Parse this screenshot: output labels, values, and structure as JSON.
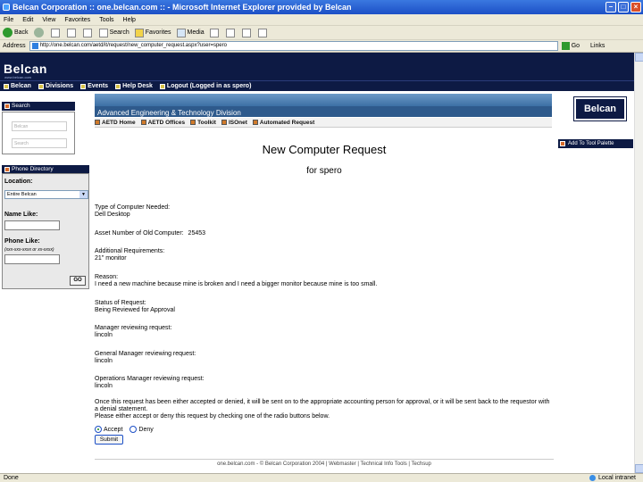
{
  "window": {
    "title": "Belcan Corporation :: one.belcan.com :: - Microsoft Internet Explorer provided by Belcan"
  },
  "menu": [
    "File",
    "Edit",
    "View",
    "Favorites",
    "Tools",
    "Help"
  ],
  "toolbar": {
    "back": "Back",
    "search": "Search",
    "favorites": "Favorites",
    "media": "Media"
  },
  "address": {
    "label": "Address",
    "url": "http://one.belcan.com/aetd/it/request/new_computer_request.aspx?user=spero",
    "go": "Go",
    "links": "Links"
  },
  "site": {
    "logo": "Belcan",
    "logo_sub": "www.belcan.com",
    "nav": [
      "Belcan",
      "Divisions",
      "Events",
      "Help Desk",
      "Logout (Logged in as spero)"
    ]
  },
  "search_panel": {
    "title": "Search",
    "field1": "Belcan",
    "field2": "Search"
  },
  "phone_panel": {
    "title": "Phone Directory",
    "location_label": "Location:",
    "location_value": "Entire Belcan",
    "name_label": "Name Like:",
    "phone_label": "Phone Like:",
    "phone_hint": "(xxx-xxx-xxxx or xx-xxxx)",
    "go": "GO"
  },
  "division": {
    "title": "Advanced Engineering & Technology Division",
    "nav": [
      "AETD Home",
      "AETD Offices",
      "Toolkit",
      "ISOnet",
      "Automated Request"
    ]
  },
  "badge": "Belcan",
  "add_toolbar": "Add To Tool Palette",
  "page": {
    "heading": "New Computer Request",
    "subheading": "for spero",
    "fields": [
      {
        "label": "Type of Computer Needed:",
        "value": "Dell Desktop"
      },
      {
        "label": "Asset Number of Old Computer:",
        "value": "25453"
      },
      {
        "label": "Additional Requirements:",
        "value": "21\" monitor"
      },
      {
        "label": "Reason:",
        "value": "I need a new machine because mine is broken and I need a bigger monitor because mine is too small."
      },
      {
        "label": "Status of Request:",
        "value": "Being Reviewed for Approval"
      },
      {
        "label": "Manager reviewing request:",
        "value": "lincoln"
      },
      {
        "label": "General Manager reviewing request:",
        "value": "lincoln"
      },
      {
        "label": "Operations Manager reviewing request:",
        "value": "lincoln"
      }
    ],
    "instructions": [
      "Once this request has been either accepted or denied, it will be sent on to the appropriate accounting person for approval, or it will be sent back to the requestor with a denial statement.",
      "Please either accept or deny this request by checking one of the radio buttons below."
    ],
    "radio_accept": "Accept",
    "radio_deny": "Deny",
    "submit": "Submit"
  },
  "footer": "one.belcan.com - © Belcan Corporation 2004 | Webmaster | Technical Info Tools | Techsup",
  "status": {
    "left": "Done",
    "right": "Local intranet"
  }
}
